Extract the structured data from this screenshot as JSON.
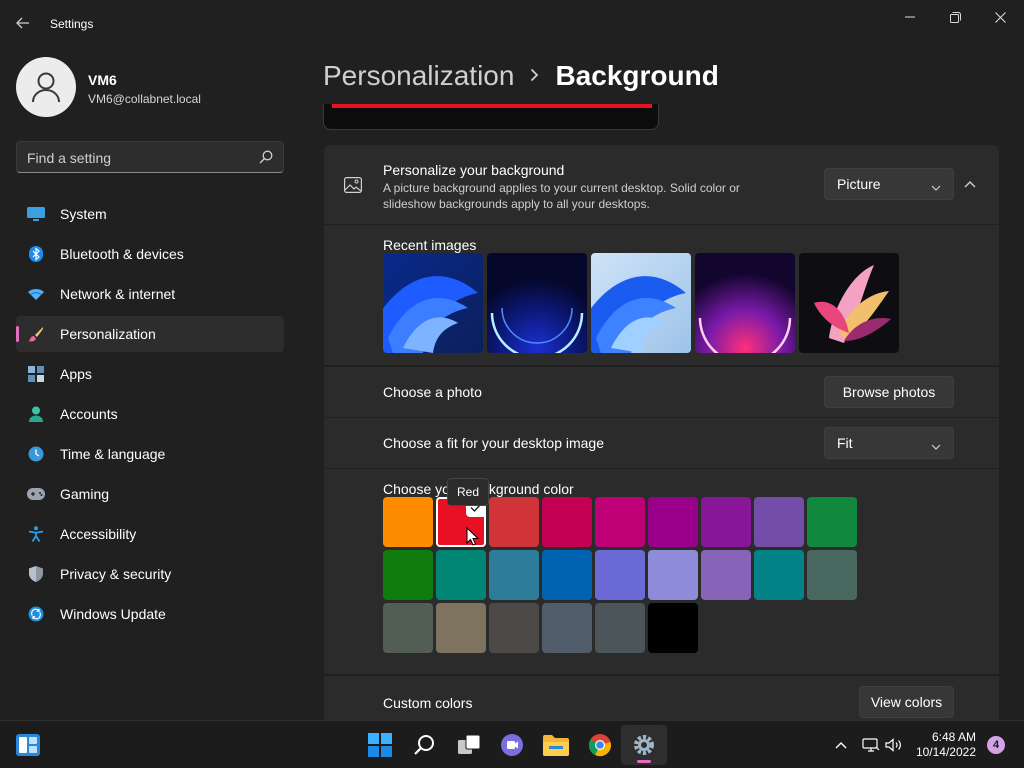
{
  "window": {
    "title": "Settings"
  },
  "user": {
    "name": "VM6",
    "email": "VM6@collabnet.local"
  },
  "search": {
    "placeholder": "Find a setting"
  },
  "nav": [
    {
      "label": "System",
      "icon": "system-icon"
    },
    {
      "label": "Bluetooth & devices",
      "icon": "bluetooth-icon"
    },
    {
      "label": "Network & internet",
      "icon": "network-icon"
    },
    {
      "label": "Personalization",
      "icon": "brush-icon",
      "active": true
    },
    {
      "label": "Apps",
      "icon": "apps-icon"
    },
    {
      "label": "Accounts",
      "icon": "accounts-icon"
    },
    {
      "label": "Time & language",
      "icon": "time-icon"
    },
    {
      "label": "Gaming",
      "icon": "gaming-icon"
    },
    {
      "label": "Accessibility",
      "icon": "accessibility-icon"
    },
    {
      "label": "Privacy & security",
      "icon": "shield-icon"
    },
    {
      "label": "Windows Update",
      "icon": "update-icon"
    }
  ],
  "breadcrumb": {
    "parent": "Personalization",
    "current": "Background"
  },
  "background": {
    "title": "Personalize your background",
    "description": "A picture background applies to your current desktop. Solid color or slideshow backgrounds apply to all your desktops.",
    "type_value": "Picture"
  },
  "recent": {
    "label": "Recent images"
  },
  "photo": {
    "label": "Choose a photo",
    "button": "Browse photos"
  },
  "fit": {
    "label": "Choose a fit for your desktop image",
    "value": "Fit"
  },
  "colors": {
    "label": "Choose your background color",
    "tooltip": "Red",
    "selected_index": 1,
    "swatches": [
      "#ff8c00",
      "#e81123",
      "#d13438",
      "#c30052",
      "#bf0077",
      "#9a0089",
      "#881798",
      "#744da9",
      "#10893e",
      "#107c10",
      "#018574",
      "#2d7d9a",
      "#0063b1",
      "#6b69d6",
      "#8e8cd8",
      "#8764b8",
      "#038387",
      "#486860",
      "#525e54",
      "#7e735f",
      "#4c4a48",
      "#515c6b",
      "#4a5459",
      "#000000"
    ]
  },
  "custom": {
    "label": "Custom colors",
    "button": "View colors"
  },
  "taskbar": {
    "time": "6:48 AM",
    "date": "10/14/2022",
    "notifications": "4"
  },
  "accent": "#e56cc3"
}
